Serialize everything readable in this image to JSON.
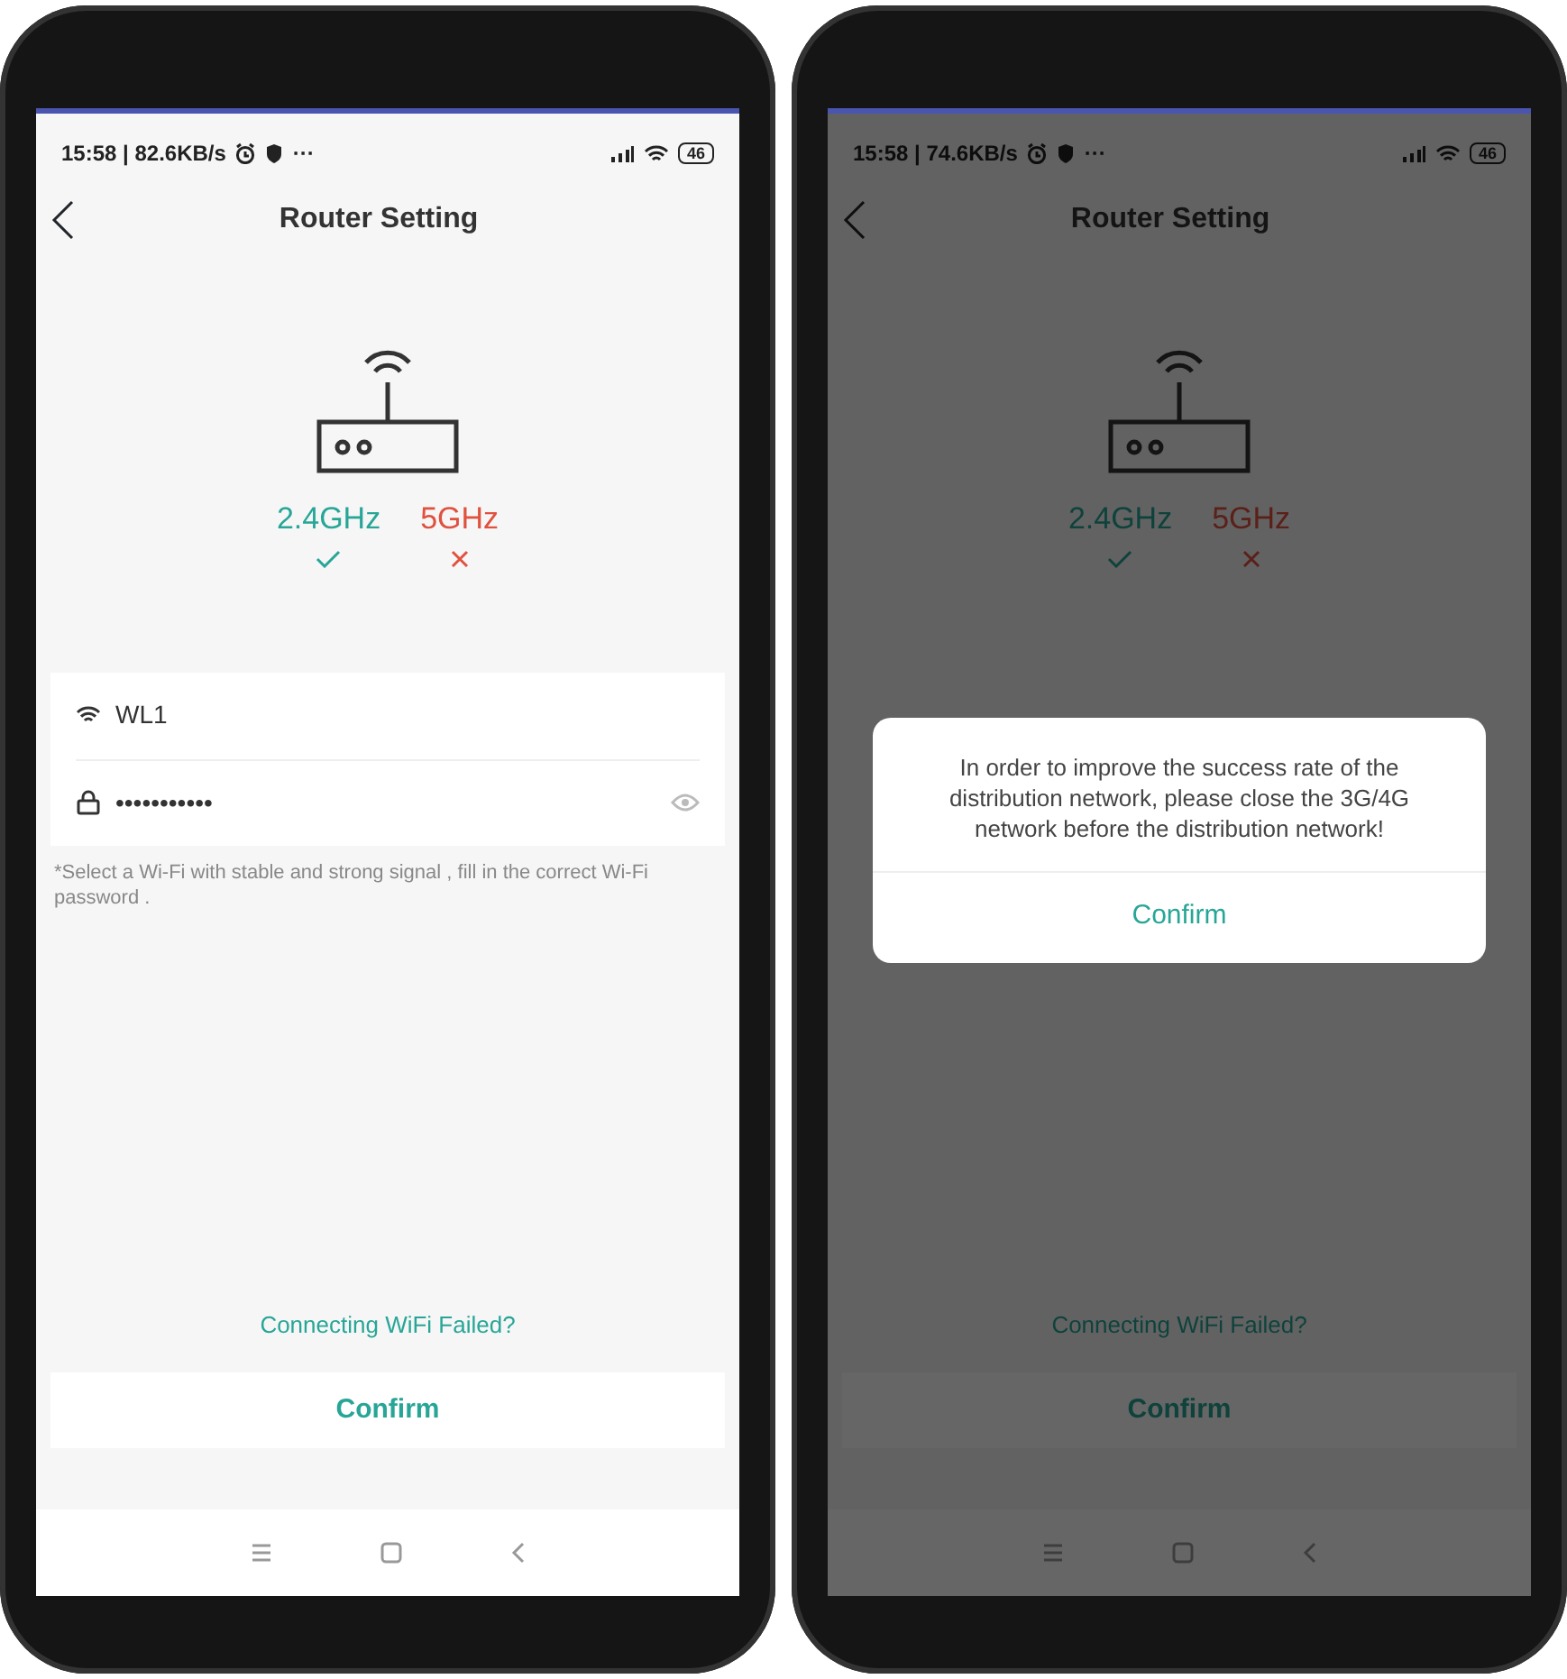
{
  "phones": [
    {
      "status_bar": {
        "time": "15:58 | 82.6KB/s",
        "more": "···",
        "battery": "46"
      },
      "title": "Router Setting",
      "bands": [
        {
          "label": "2.4GHz",
          "supported": true
        },
        {
          "label": "5GHz",
          "supported": false
        }
      ],
      "ssid": "WL1",
      "password": "•••••••••••",
      "hint": "*Select a Wi-Fi with stable and strong signal , fill in the correct Wi-Fi password .",
      "help_link": "Connecting WiFi Failed?",
      "confirm": "Confirm"
    },
    {
      "status_bar": {
        "time": "15:58 | 74.6KB/s",
        "more": "···",
        "battery": "46"
      },
      "title": "Router Setting",
      "bands": [
        {
          "label": "2.4GHz",
          "supported": true
        },
        {
          "label": "5GHz",
          "supported": false
        }
      ],
      "help_link": "Connecting WiFi Failed?",
      "confirm": "Confirm",
      "dialog": {
        "message": "In order to improve the success rate of the distribution network, please close the 3G/4G network before the distribution network!",
        "button": "Confirm"
      }
    }
  ]
}
